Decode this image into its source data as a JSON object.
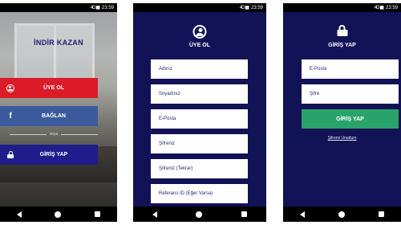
{
  "status_bar": {
    "time": "23:59",
    "signal": "4G ▮▮"
  },
  "screen_home": {
    "app_title": "İNDİR KAZAN",
    "register_label": "ÜYE OL",
    "connect_label": "BAĞLAN",
    "or_label": "veya",
    "login_label": "GİRİŞ YAP",
    "colors": {
      "register": "#db1b27",
      "facebook": "#3a5a9b",
      "login": "#1f1d8c"
    }
  },
  "screen_register": {
    "title": "ÜYE OL",
    "fields": [
      {
        "placeholder": "Adınız"
      },
      {
        "placeholder": "Soyadınız"
      },
      {
        "placeholder": "E-Posta"
      },
      {
        "placeholder": "Şifreniz"
      },
      {
        "placeholder": "Şifreniz (Tekrar)"
      },
      {
        "placeholder": "Referans ID (Eğer Varsa)"
      }
    ]
  },
  "screen_login": {
    "title": "GİRİŞ YAP",
    "email_placeholder": "E-Posta",
    "password_placeholder": "Şifre",
    "login_button": "GİRİŞ YAP",
    "forgot_link": "Şifremi Unuttum",
    "colors": {
      "background": "#121257",
      "login_button": "#2aa36a"
    }
  },
  "icons": [
    "user-circle-icon",
    "facebook-icon",
    "lock-icon",
    "back-icon",
    "home-icon",
    "recent-apps-icon"
  ]
}
